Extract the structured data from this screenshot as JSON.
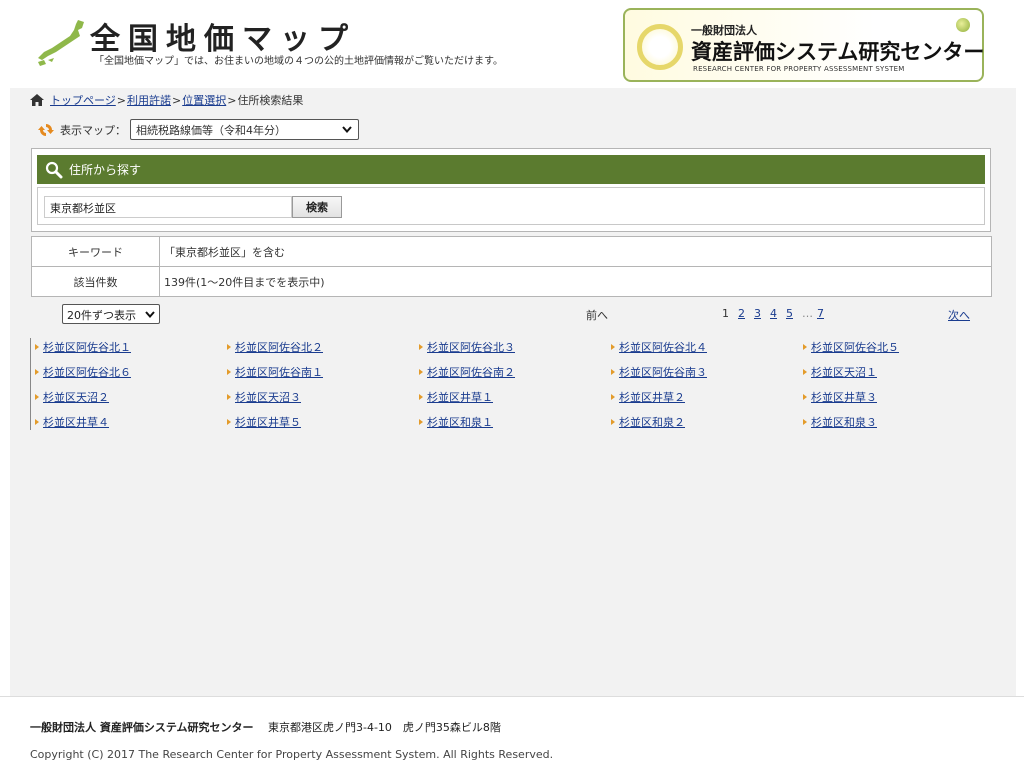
{
  "header": {
    "site_title": "全国地価マップ",
    "site_subtitle": "「全国地価マップ」では、お住まいの地域の４つの公的土地評価情報がご覧いただけます。",
    "org_small": "一般財団法人",
    "org_name": "資産評価システム研究センター",
    "org_en": "RESEARCH CENTER FOR PROPERTY ASSESSMENT SYSTEM"
  },
  "breadcrumb": {
    "items": [
      {
        "label": "トップページ",
        "link": true
      },
      {
        "label": "利用許諾",
        "link": true
      },
      {
        "label": "位置選択",
        "link": true
      },
      {
        "label": "住所検索結果",
        "link": false
      }
    ],
    "separator": ">"
  },
  "map_select": {
    "label": "表示マップ：",
    "selected": "相続税路線価等（令和4年分）"
  },
  "search": {
    "header": "住所から探す",
    "value": "東京都杉並区",
    "button": "検索"
  },
  "result_table": {
    "rows": [
      {
        "label": "キーワード",
        "value": "「東京都杉並区」を含む"
      },
      {
        "label": "該当件数",
        "value": "139件(1～20件目までを表示中)"
      }
    ]
  },
  "pager": {
    "per_page": "20件ずつ表示",
    "prev": "前へ",
    "pages": [
      "1",
      "2",
      "3",
      "4",
      "5"
    ],
    "current_page": "1",
    "ellipsis": "…",
    "last_page": "7",
    "next": "次へ"
  },
  "results": [
    "杉並区阿佐谷北１",
    "杉並区阿佐谷北２",
    "杉並区阿佐谷北３",
    "杉並区阿佐谷北４",
    "杉並区阿佐谷北５",
    "杉並区阿佐谷北６",
    "杉並区阿佐谷南１",
    "杉並区阿佐谷南２",
    "杉並区阿佐谷南３",
    "杉並区天沼１",
    "杉並区天沼２",
    "杉並区天沼３",
    "杉並区井草１",
    "杉並区井草２",
    "杉並区井草３",
    "杉並区井草４",
    "杉並区井草５",
    "杉並区和泉１",
    "杉並区和泉２",
    "杉並区和泉３"
  ],
  "footer": {
    "org": "一般財団法人 資産評価システム研究センター",
    "address": "東京都港区虎ノ門3-4-10　虎ノ門35森ビル8階",
    "copyright": "Copyright (C) 2017 The Research Center for Property Assessment System. All Rights Reserved."
  },
  "colors": {
    "accent_green": "#5b7b2f",
    "link_blue": "#1a3c8f",
    "bullet_orange": "#e39b2a"
  },
  "icons": [
    "japan-map-icon",
    "home-icon",
    "refresh-icon",
    "magnify-icon",
    "chevron-down-icon",
    "bullet-icon"
  ]
}
